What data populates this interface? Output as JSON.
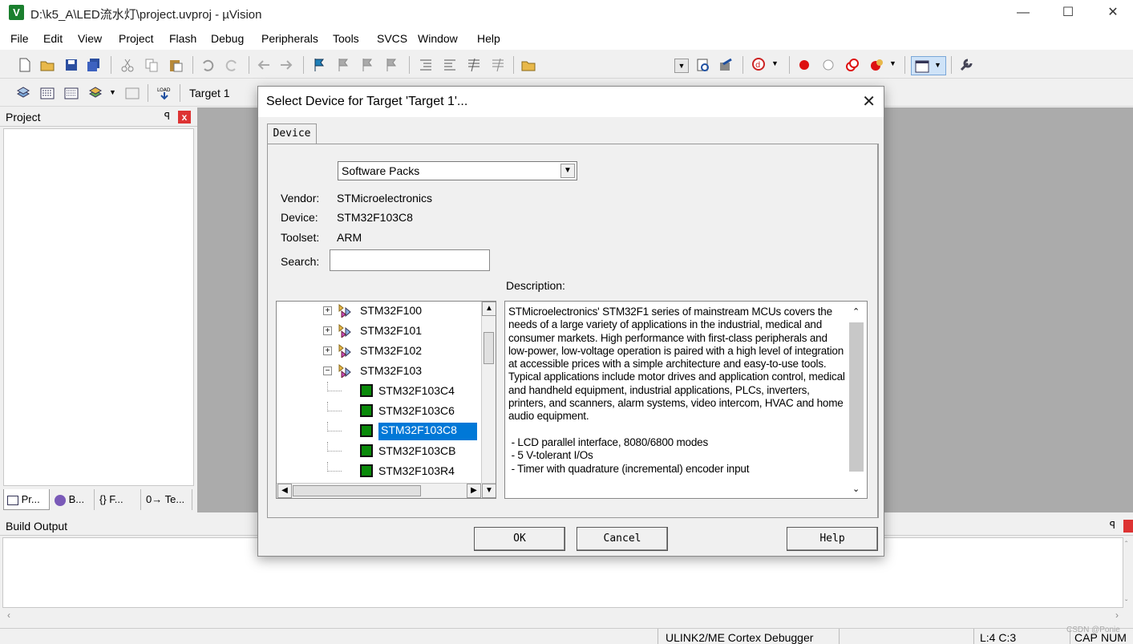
{
  "window": {
    "title": "D:\\k5_A\\LED流水灯\\project.uvproj - µVision",
    "minimize": "—",
    "maximize": "☐",
    "close": "✕"
  },
  "menu": [
    "File",
    "Edit",
    "View",
    "Project",
    "Flash",
    "Debug",
    "Peripherals",
    "Tools",
    "SVCS",
    "Window",
    "Help"
  ],
  "toolbar2": {
    "target": "Target 1"
  },
  "project_panel": {
    "title": "Project",
    "pin": "ꟼ",
    "close": "x",
    "tabs": [
      "Pr...",
      "B...",
      "{} F...",
      "0→ Te..."
    ]
  },
  "build_output": {
    "title": "Build Output",
    "pin": "ꟼ"
  },
  "status": {
    "debugger": "ULINK2/ME Cortex Debugger",
    "position": "L:4 C:3",
    "cap": "CAP",
    "num": "NUM",
    "watermark": "CSDN @Ponie"
  },
  "dialog": {
    "title": "Select Device for Target 'Target 1'...",
    "close": "✕",
    "tab": "Device",
    "selector": {
      "value": "Software Packs"
    },
    "vendor_label": "Vendor:",
    "vendor": "STMicroelectronics",
    "device_label": "Device:",
    "device": "STM32F103C8",
    "toolset_label": "Toolset:",
    "toolset": "ARM",
    "search_label": "Search:",
    "search_value": "",
    "description_label": "Description:",
    "tree": [
      {
        "label": "STM32F100",
        "kind": "family",
        "expander": "+"
      },
      {
        "label": "STM32F101",
        "kind": "family",
        "expander": "+"
      },
      {
        "label": "STM32F102",
        "kind": "family",
        "expander": "+"
      },
      {
        "label": "STM32F103",
        "kind": "family",
        "expander": "−"
      },
      {
        "label": "STM32F103C4",
        "kind": "device"
      },
      {
        "label": "STM32F103C6",
        "kind": "device"
      },
      {
        "label": "STM32F103C8",
        "kind": "device",
        "selected": true
      },
      {
        "label": "STM32F103CB",
        "kind": "device"
      },
      {
        "label": "STM32F103R4",
        "kind": "device"
      }
    ],
    "description": "STMicroelectronics' STM32F1 series of mainstream MCUs covers the needs of a large variety of applications in the industrial, medical and consumer markets. High performance with first-class peripherals and low-power, low-voltage operation is paired with a high level of integration at accessible prices with a simple architecture and easy-to-use tools.\nTypical applications include motor drives and application control, medical and handheld equipment, industrial applications, PLCs, inverters, printers, and scanners, alarm systems, video intercom, HVAC and home audio equipment.\n\n - LCD parallel interface, 8080/6800 modes\n - 5 V-tolerant I/Os\n - Timer with quadrature (incremental) encoder input",
    "buttons": {
      "ok": "OK",
      "cancel": "Cancel",
      "help": "Help"
    }
  },
  "colors": {
    "selection": "#0078d7",
    "editor_bg": "#ababab",
    "chip_green": "#0a8a0a"
  }
}
